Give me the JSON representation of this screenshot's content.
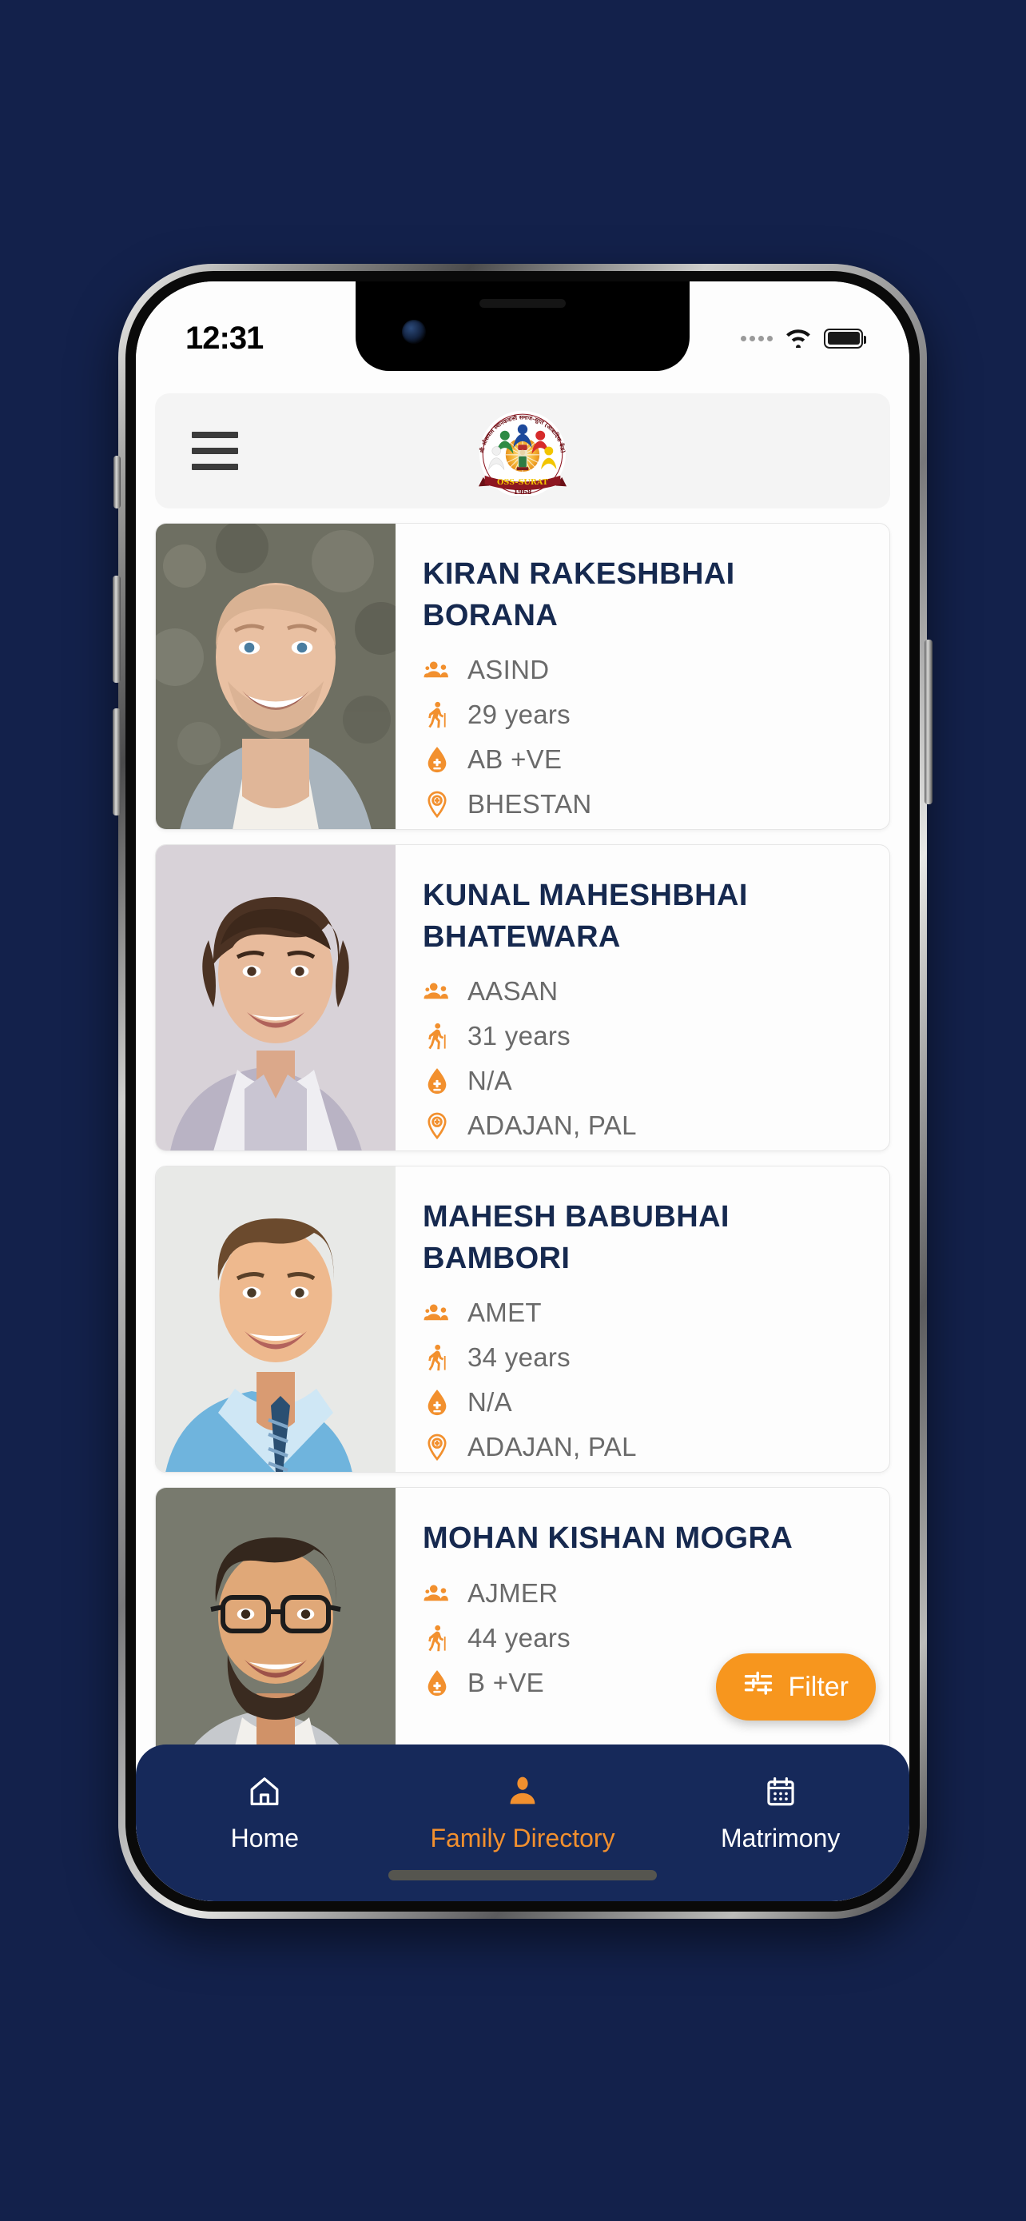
{
  "statusbar": {
    "time": "12:31",
    "signal_icon": "cellular-dots-icon",
    "wifi_icon": "wifi-icon",
    "battery_icon": "battery-full-icon"
  },
  "header": {
    "menu_icon": "hamburger-menu-icon",
    "logo": {
      "name": "oss-surat-logo",
      "ribbon_text": "OSS-SURAT",
      "year_text": "1968"
    }
  },
  "colors": {
    "page_background": "#13214b",
    "accent_orange": "#f2902e",
    "filter_orange": "#f7961e",
    "nav_navy": "#16295a",
    "name_navy": "#16294f",
    "meta_gray": "#6a6a6a",
    "header_gray": "#f4f4f4"
  },
  "directory": {
    "cards": [
      {
        "name": "KIRAN RAKESHBHAI BORANA",
        "community": "ASIND",
        "age": "29 years",
        "blood_group": "AB +VE",
        "location": "BHESTAN",
        "photo": "portrait-bald-man-gray-blazer"
      },
      {
        "name": "KUNAL MAHESHBHAI BHATEWARA",
        "community": "AASAN",
        "age": "31 years",
        "blood_group": "N/A",
        "location": "ADAJAN, PAL",
        "photo": "portrait-young-man-lavender-shirt"
      },
      {
        "name": "MAHESH BABUBHAI BAMBORI",
        "community": "AMET",
        "age": "34 years",
        "blood_group": "N/A",
        "location": "ADAJAN, PAL",
        "photo": "portrait-man-blue-shirt-tie"
      },
      {
        "name": "MOHAN KISHAN MOGRA",
        "community": "AJMER",
        "age": "44 years",
        "blood_group": "B +VE",
        "location": "",
        "photo": "portrait-bearded-man-glasses"
      }
    ],
    "icon_names": {
      "community": "people-group-icon",
      "age": "elderly-walking-icon",
      "blood": "blood-drop-icon",
      "location": "location-pin-icon"
    }
  },
  "filter_button": {
    "label": "Filter",
    "icon": "sliders-filter-icon"
  },
  "bottom_nav": {
    "items": [
      {
        "label": "Home",
        "icon": "home-icon",
        "active": false
      },
      {
        "label": "Family Directory",
        "icon": "person-icon",
        "active": true
      },
      {
        "label": "Matrimony",
        "icon": "calendar-icon",
        "active": false
      }
    ]
  }
}
